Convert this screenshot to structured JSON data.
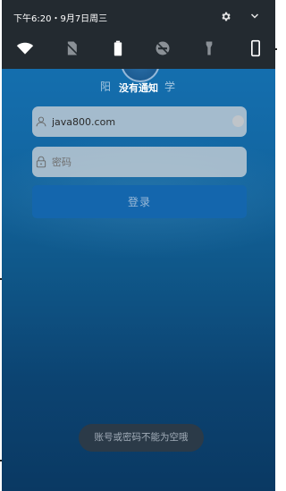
{
  "status_bar": {
    "time_date": "下午6:20・9月7日周三",
    "settings_icon": "gear-icon",
    "expand_icon": "chevron-down-icon"
  },
  "quick_settings": [
    {
      "name": "wifi",
      "icon": "wifi-icon",
      "active": true
    },
    {
      "name": "no-sim",
      "icon": "no-sim-icon",
      "active": false
    },
    {
      "name": "battery",
      "icon": "battery-icon",
      "active": true
    },
    {
      "name": "do-not-disturb",
      "icon": "dnd-off-icon",
      "active": false
    },
    {
      "name": "flashlight",
      "icon": "flashlight-icon",
      "active": false
    },
    {
      "name": "screen-rotation",
      "icon": "phone-portrait-icon",
      "active": true
    }
  ],
  "notifications": {
    "empty_text": "没有通知"
  },
  "app": {
    "school_left": "阳",
    "school_right": "学"
  },
  "login": {
    "username_value": "java800.com",
    "password_placeholder": "密码",
    "submit_label": "登录"
  },
  "toast": {
    "message": "账号或密码不能为空哦"
  },
  "colors": {
    "background_top": "#1674b6",
    "background_bottom": "#0a3963",
    "shade": "#232a30",
    "button": "#1466ad",
    "toast": "#2b3a48"
  }
}
